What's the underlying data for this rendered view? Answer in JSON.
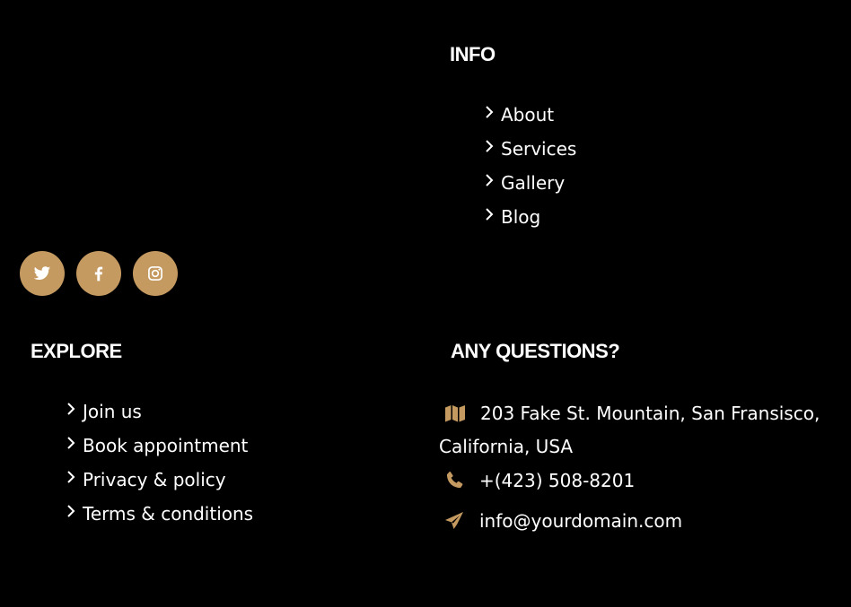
{
  "colors": {
    "accent": "#C59A61",
    "background": "#000000",
    "text": "#FFFFFF"
  },
  "info": {
    "heading": "INFO",
    "links": [
      "About",
      "Services",
      "Gallery",
      "Blog"
    ]
  },
  "social": {
    "items": [
      {
        "name": "twitter",
        "icon": "twitter-icon"
      },
      {
        "name": "facebook",
        "icon": "facebook-icon"
      },
      {
        "name": "instagram",
        "icon": "instagram-icon"
      }
    ]
  },
  "explore": {
    "heading": "EXPLORE",
    "links": [
      "Join us",
      "Book appointment",
      "Privacy & policy",
      "Terms & conditions"
    ]
  },
  "questions": {
    "heading": "ANY QUESTIONS?",
    "address_line1": "203 Fake St. Mountain, San Fransisco,",
    "address_line2": "California, USA",
    "phone": "+(423) 508-8201",
    "email": "info@yourdomain.com",
    "address_icon": "map-icon",
    "phone_icon": "phone-icon",
    "email_icon": "paper-plane-icon"
  }
}
